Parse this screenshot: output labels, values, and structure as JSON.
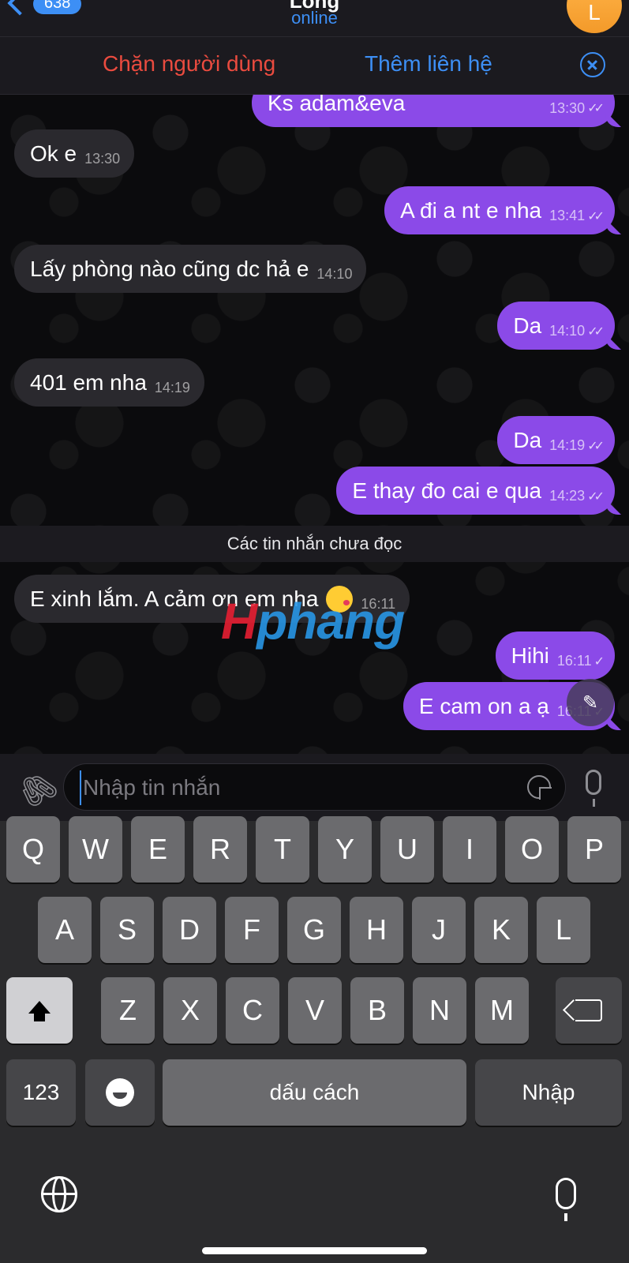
{
  "header": {
    "back_count": "638",
    "contact_name": "Long",
    "status": "online",
    "avatar_letter": "L"
  },
  "action_bar": {
    "block_label": "Chặn người dùng",
    "add_contact_label": "Thêm liên hệ"
  },
  "messages": [
    {
      "dir": "out",
      "text": "Ks adam&eva",
      "time": "13:30"
    },
    {
      "dir": "in",
      "text": "Ok e",
      "time": "13:30"
    },
    {
      "dir": "out",
      "text": "A đi a nt e nha",
      "time": "13:41"
    },
    {
      "dir": "in",
      "text": "Lấy phòng nào cũng dc hả e",
      "time": "14:10"
    },
    {
      "dir": "out",
      "text": "Da",
      "time": "14:10"
    },
    {
      "dir": "in",
      "text": "401 em nha",
      "time": "14:19"
    },
    {
      "dir": "out",
      "text": "Da",
      "time": "14:19"
    },
    {
      "dir": "out",
      "text": "E thay đo cai e qua",
      "time": "14:23"
    },
    {
      "dir": "in",
      "text": "E xinh lắm. A cảm ơn em nha",
      "time": "16:11"
    },
    {
      "dir": "out",
      "text": "Hihi",
      "time": "16:11"
    },
    {
      "dir": "out",
      "text": "E cam on a ạ",
      "time": "16:11"
    }
  ],
  "unread_label": "Các tin nhắn chưa đọc",
  "watermark": {
    "part1": "H",
    "part2": "phang"
  },
  "composer": {
    "placeholder": "Nhập tin nhắn"
  },
  "keyboard": {
    "row1": [
      "Q",
      "W",
      "E",
      "R",
      "T",
      "Y",
      "U",
      "I",
      "O",
      "P"
    ],
    "row2": [
      "A",
      "S",
      "D",
      "F",
      "G",
      "H",
      "J",
      "K",
      "L"
    ],
    "row3": [
      "Z",
      "X",
      "C",
      "V",
      "B",
      "N",
      "M"
    ],
    "numbers_label": "123",
    "space_label": "dấu cách",
    "return_label": "Nhập"
  },
  "colors": {
    "outgoing_bubble": "#8b4ae8",
    "incoming_bubble": "#2a292e",
    "accent": "#3d8ff5",
    "danger": "#ea4b3f"
  }
}
